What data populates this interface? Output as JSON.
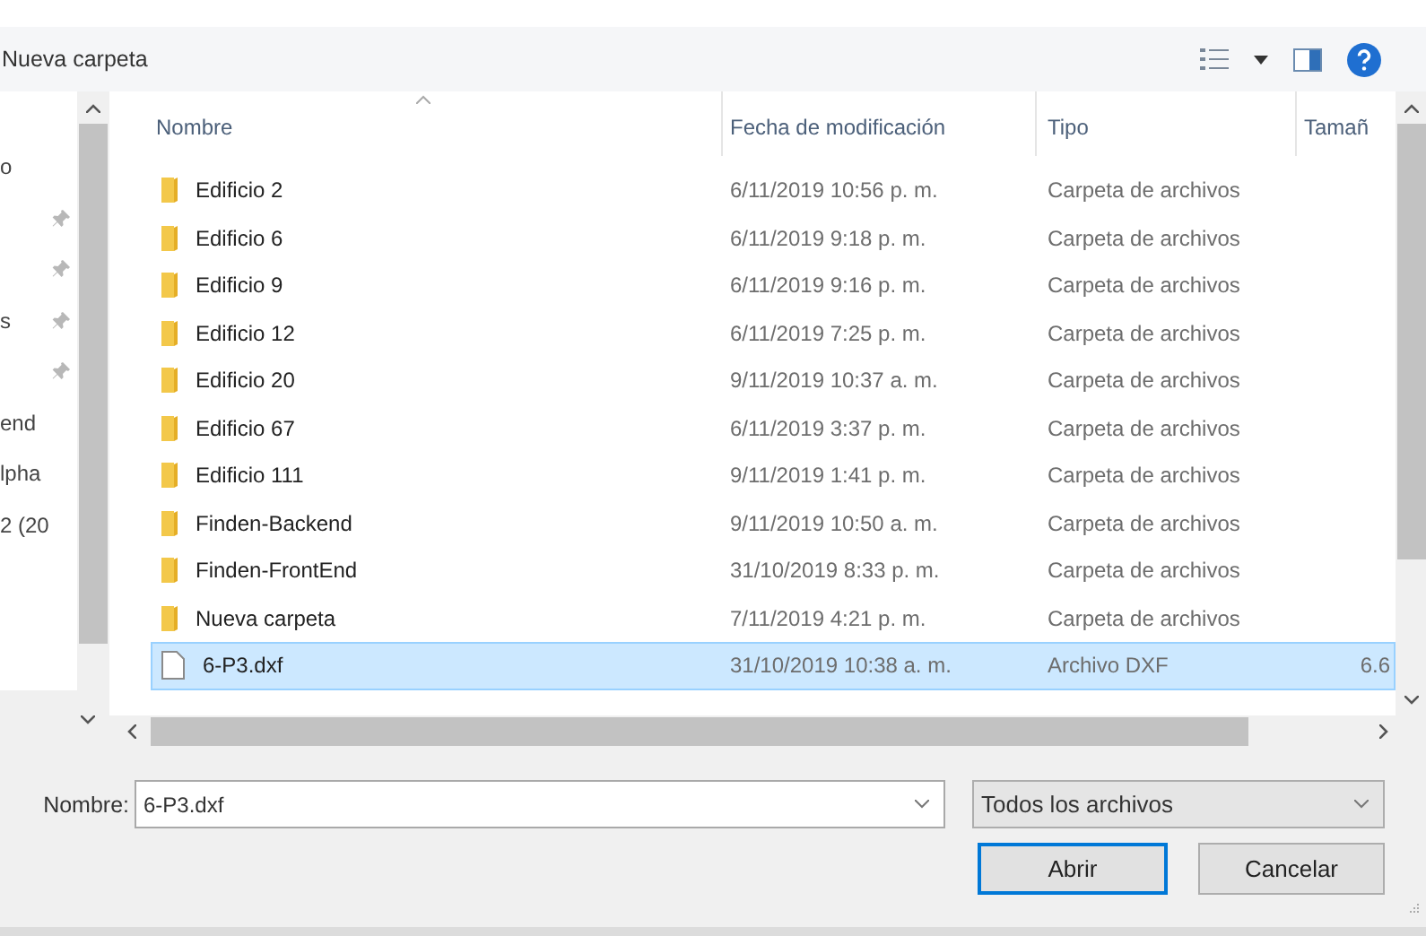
{
  "toolbar": {
    "breadcrumb": "Nueva carpeta"
  },
  "nav_items": [
    {
      "label": "o",
      "pinned": false
    },
    {
      "pinned": true
    },
    {
      "pinned": true
    },
    {
      "label": "s",
      "pinned": true
    },
    {
      "pinned": true
    },
    {
      "label": "end",
      "pinned": false
    },
    {
      "label": "lpha",
      "pinned": false
    },
    {
      "label": "2 (20",
      "pinned": false
    }
  ],
  "columns": [
    {
      "label": "Nombre",
      "sorted": true
    },
    {
      "label": "Fecha de modificación",
      "sorted": false
    },
    {
      "label": "Tipo",
      "sorted": false
    },
    {
      "label": "Tamañ",
      "sorted": false
    }
  ],
  "rows": [
    {
      "kind": "folder",
      "name": "Edificio 2",
      "date": "6/11/2019 10:56 p. m.",
      "type": "Carpeta de archivos",
      "selected": false
    },
    {
      "kind": "folder",
      "name": "Edificio 6",
      "date": "6/11/2019 9:18 p. m.",
      "type": "Carpeta de archivos",
      "selected": false
    },
    {
      "kind": "folder",
      "name": "Edificio 9",
      "date": "6/11/2019 9:16 p. m.",
      "type": "Carpeta de archivos",
      "selected": false
    },
    {
      "kind": "folder",
      "name": "Edificio 12",
      "date": "6/11/2019 7:25 p. m.",
      "type": "Carpeta de archivos",
      "selected": false
    },
    {
      "kind": "folder",
      "name": "Edificio 20",
      "date": "9/11/2019 10:37 a. m.",
      "type": "Carpeta de archivos",
      "selected": false
    },
    {
      "kind": "folder",
      "name": "Edificio 67",
      "date": "6/11/2019 3:37 p. m.",
      "type": "Carpeta de archivos",
      "selected": false
    },
    {
      "kind": "folder",
      "name": "Edificio 111",
      "date": "9/11/2019 1:41 p. m.",
      "type": "Carpeta de archivos",
      "selected": false
    },
    {
      "kind": "folder",
      "name": "Finden-Backend",
      "date": "9/11/2019 10:50 a. m.",
      "type": "Carpeta de archivos",
      "selected": false
    },
    {
      "kind": "folder",
      "name": "Finden-FrontEnd",
      "date": "31/10/2019 8:33 p. m.",
      "type": "Carpeta de archivos",
      "selected": false
    },
    {
      "kind": "folder",
      "name": "Nueva carpeta",
      "date": "7/11/2019 4:21 p. m.",
      "type": "Carpeta de archivos",
      "selected": false
    },
    {
      "kind": "file",
      "name": "6-P3.dxf",
      "date": "31/10/2019 10:38 a. m.",
      "type": "Archivo DXF",
      "size": "6.6",
      "selected": true
    }
  ],
  "filename": {
    "label": "Nombre:",
    "value": "6-P3.dxf"
  },
  "filter": {
    "value": "Todos los archivos"
  },
  "buttons": [
    {
      "label": "Abrir",
      "default": true
    },
    {
      "label": "Cancelar",
      "default": false
    }
  ]
}
